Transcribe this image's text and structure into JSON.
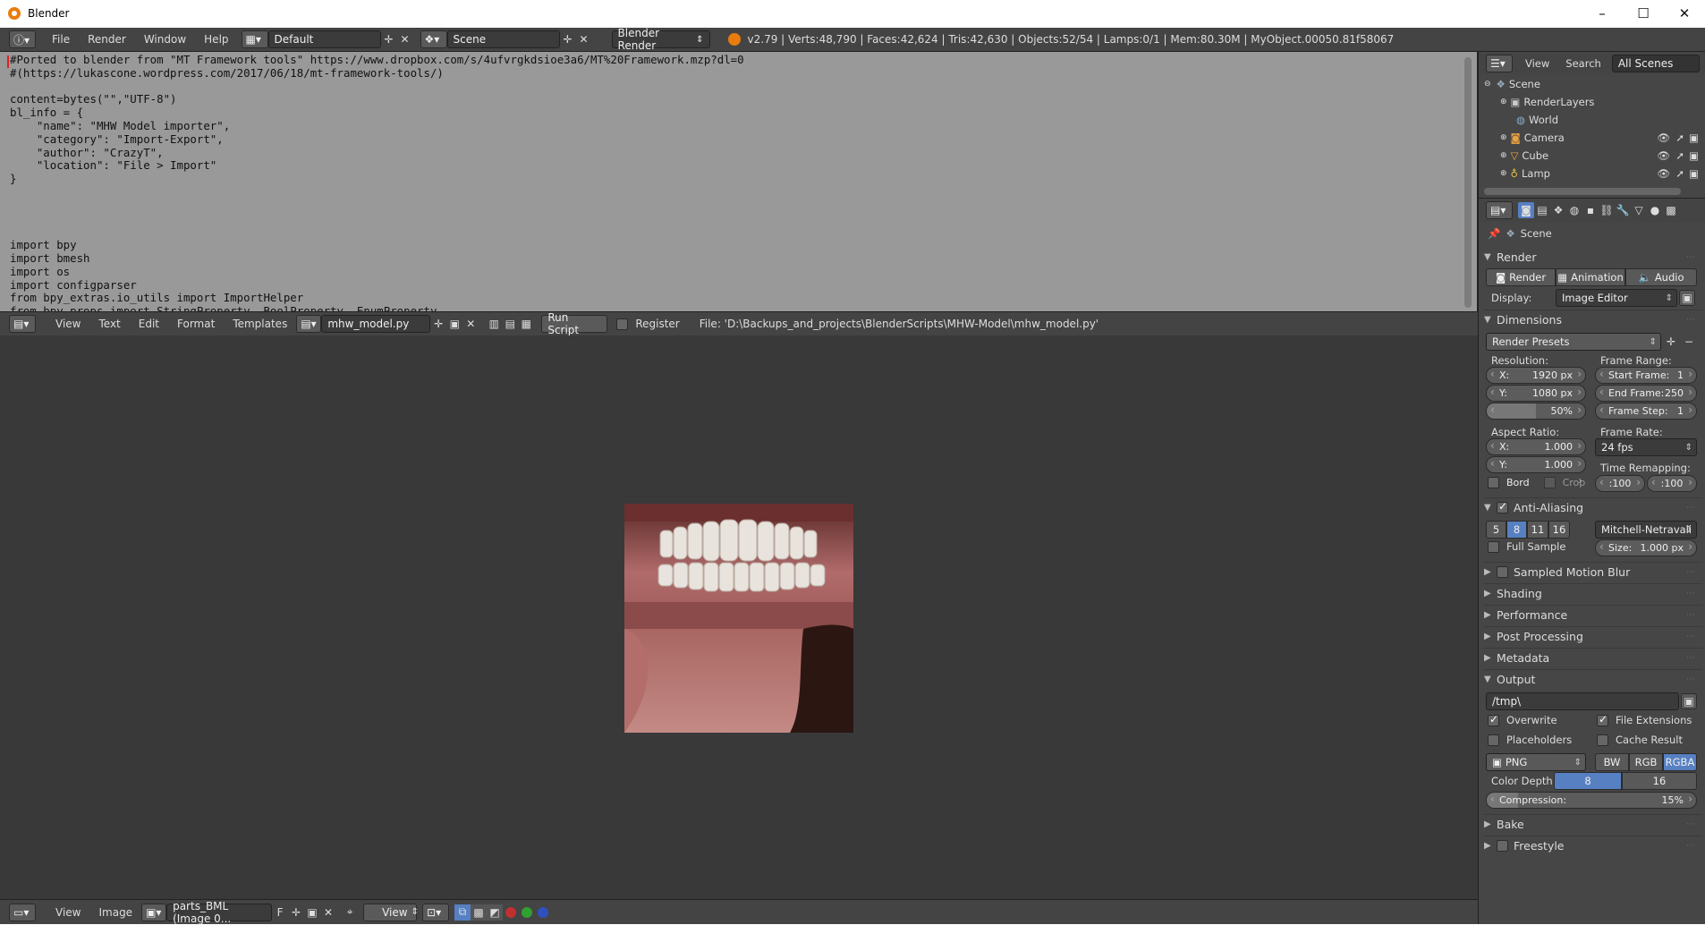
{
  "window": {
    "title": "Blender",
    "min": "–",
    "max": "☐",
    "close": "✕"
  },
  "topbar": {
    "menus": [
      "File",
      "Render",
      "Window",
      "Help"
    ],
    "layout": "Default",
    "scene": "Scene",
    "engine": "Blender Render",
    "stats": "v2.79 | Verts:48,790 | Faces:42,624 | Tris:42,630 | Objects:52/54 | Lamps:0/1 | Mem:80.30M | MyObject.00050.81f58067"
  },
  "text_editor": {
    "lines": [
      "#Ported to blender from \"MT Framework tools\" https://www.dropbox.com/s/4ufvrgkdsioe3a6/MT%20Framework.mzp?dl=0",
      "#(https://lukascone.wordpress.com/2017/06/18/mt-framework-tools/)",
      "",
      "content=bytes(\"\",\"UTF-8\")",
      "bl_info = {",
      "    \"name\": \"MHW Model importer\",",
      "    \"category\": \"Import-Export\",",
      "    \"author\": \"CrazyT\",",
      "    \"location\": \"File > Import\"",
      "}",
      "",
      "",
      "",
      "",
      "import bpy",
      "import bmesh",
      "import os",
      "import configparser",
      "from bpy_extras.io_utils import ImportHelper",
      "from bpy.props import StringProperty, BoolProperty, EnumProperty"
    ],
    "header": {
      "menus": [
        "View",
        "Text",
        "Edit",
        "Format",
        "Templates"
      ],
      "filename": "mhw_model.py",
      "run_script": "Run Script",
      "register": "Register",
      "file_path": "File: 'D:\\Backups_and_projects\\BlenderScripts\\MHW-Model\\mhw_model.py'"
    }
  },
  "image_editor": {
    "header": {
      "menus": [
        "View",
        "Image"
      ],
      "image_name": "parts_BML (Image 0...",
      "fake_user": "F",
      "view": "View"
    }
  },
  "outliner": {
    "menus": [
      "View",
      "Search"
    ],
    "scope": "All Scenes",
    "items": [
      {
        "label": "Scene"
      },
      {
        "label": "RenderLayers"
      },
      {
        "label": "World"
      },
      {
        "label": "Camera"
      },
      {
        "label": "Cube"
      },
      {
        "label": "Lamp"
      }
    ]
  },
  "properties": {
    "context": "Scene",
    "render": {
      "title": "Render",
      "buttons": [
        "Render",
        "Animation",
        "Audio"
      ],
      "display_label": "Display:",
      "display_value": "Image Editor"
    },
    "dimensions": {
      "title": "Dimensions",
      "presets": "Render Presets",
      "resolution_label": "Resolution:",
      "res_x_label": "X:",
      "res_x": "1920 px",
      "res_y_label": "Y:",
      "res_y": "1080 px",
      "res_pct": "50%",
      "frame_range_label": "Frame Range:",
      "start_label": "Start Frame:",
      "start": "1",
      "end_label": "End Frame:",
      "end": "250",
      "step_label": "Frame Step:",
      "step": "1",
      "aspect_label": "Aspect Ratio:",
      "asp_x_label": "X:",
      "asp_x": "1.000",
      "asp_y_label": "Y:",
      "asp_y": "1.000",
      "frame_rate_label": "Frame Rate:",
      "frame_rate": "24 fps",
      "remap_label": "Time Remapping:",
      "remap_old": ":100",
      "remap_new": ":100",
      "bord": "Bord",
      "crop": "Crop"
    },
    "antialiasing": {
      "title": "Anti-Aliasing",
      "samples": [
        "5",
        "8",
        "11",
        "16"
      ],
      "filter": "Mitchell-Netravali",
      "full_sample": "Full Sample",
      "size_label": "Size:",
      "size": "1.000 px"
    },
    "collapsed_panels": [
      "Sampled Motion Blur",
      "Shading",
      "Performance",
      "Post Processing",
      "Metadata"
    ],
    "output": {
      "title": "Output",
      "path": "/tmp\\",
      "overwrite": "Overwrite",
      "file_ext": "File Extensions",
      "placeholders": "Placeholders",
      "cache": "Cache Result",
      "format": "PNG",
      "modes": [
        "BW",
        "RGB",
        "RGBA"
      ],
      "color_depth_label": "Color Depth:",
      "depths": [
        "8",
        "16"
      ],
      "compression_label": "Compression:",
      "compression": "15%"
    },
    "bake": "Bake",
    "freestyle": "Freestyle"
  },
  "colors": {
    "accent": "#5680c2",
    "header": "#444444",
    "editor_bg": "#393939",
    "text_bg": "#999999"
  }
}
